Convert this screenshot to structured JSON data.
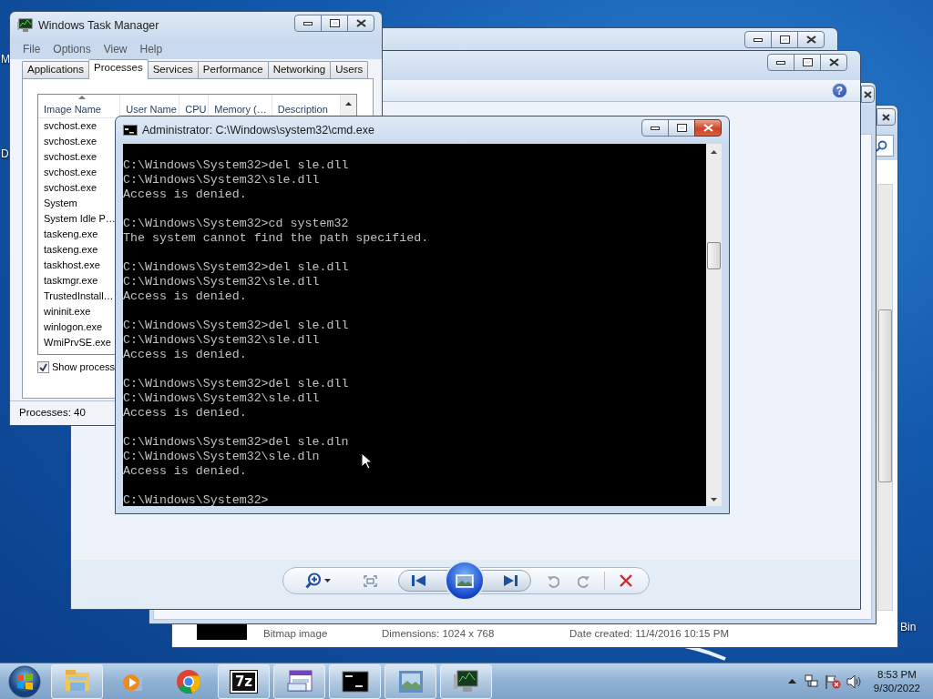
{
  "desktop": {
    "labels": [
      "M",
      "D",
      "Bin"
    ]
  },
  "explorer_window": {
    "details": [
      "Bitmap image",
      "Dimensions: 1024 x 768",
      "Date created: 11/4/2016 10:15 PM"
    ]
  },
  "photo_viewer": {
    "help_label": "?",
    "toolbar": [
      {
        "kind": "zoom"
      },
      {
        "kind": "fit"
      },
      {
        "kind": "nav"
      },
      {
        "kind": "rotate-left"
      },
      {
        "kind": "rotate-right"
      },
      {
        "kind": "separator"
      },
      {
        "kind": "delete"
      }
    ]
  },
  "task_manager": {
    "title": "Windows Task Manager",
    "menu": [
      "File",
      "Options",
      "View",
      "Help"
    ],
    "tabs": [
      {
        "label": "Applications",
        "selected": false
      },
      {
        "label": "Processes",
        "selected": true
      },
      {
        "label": "Services",
        "selected": false
      },
      {
        "label": "Performance",
        "selected": false
      },
      {
        "label": "Networking",
        "selected": false
      },
      {
        "label": "Users",
        "selected": false
      }
    ],
    "columns": [
      {
        "label": "Image Name",
        "sorted": true
      },
      {
        "label": "User Name",
        "sorted": false
      },
      {
        "label": "CPU",
        "sorted": false
      },
      {
        "label": "Memory (…",
        "sorted": false
      },
      {
        "label": "Description",
        "sorted": false
      }
    ],
    "rows": [
      "svchost.exe",
      "svchost.exe",
      "svchost.exe",
      "svchost.exe",
      "svchost.exe",
      "System",
      "System Idle P…",
      "taskeng.exe",
      "taskeng.exe",
      "taskhost.exe",
      "taskmgr.exe",
      "TrustedInstall…",
      "wininit.exe",
      "winlogon.exe",
      "WmiPrvSE.exe"
    ],
    "show_all": {
      "label": "Show process",
      "checked": true
    },
    "status": "Processes: 40"
  },
  "cmd": {
    "title": "Administrator: C:\\Windows\\system32\\cmd.exe",
    "blocks": [
      [
        "C:\\Windows\\System32>del sle.dll",
        "C:\\Windows\\System32\\sle.dll",
        "Access is denied."
      ],
      [
        "C:\\Windows\\System32>cd system32",
        "The system cannot find the path specified."
      ],
      [
        "C:\\Windows\\System32>del sle.dll",
        "C:\\Windows\\System32\\sle.dll",
        "Access is denied."
      ],
      [
        "C:\\Windows\\System32>del sle.dll",
        "C:\\Windows\\System32\\sle.dll",
        "Access is denied."
      ],
      [
        "C:\\Windows\\System32>del sle.dll",
        "C:\\Windows\\System32\\sle.dll",
        "Access is denied."
      ],
      [
        "C:\\Windows\\System32>del sle.dln",
        "C:\\Windows\\System32\\sle.dln",
        "Access is denied."
      ],
      [
        "C:\\Windows\\System32>"
      ]
    ]
  },
  "taskbar": {
    "items": [
      {
        "kind": "explorer",
        "running": true
      },
      {
        "kind": "media",
        "running": false
      },
      {
        "kind": "chrome",
        "running": false
      },
      {
        "kind": "sevenzip",
        "running": true,
        "glyph": "7z"
      },
      {
        "kind": "app",
        "running": true
      },
      {
        "kind": "cmd",
        "running": true
      },
      {
        "kind": "photos",
        "running": true
      },
      {
        "kind": "taskmgr",
        "running": true
      }
    ],
    "tray": [
      {
        "kind": "arrow"
      },
      {
        "kind": "network"
      },
      {
        "kind": "flag"
      },
      {
        "kind": "speaker"
      }
    ],
    "time": "8:53 PM",
    "date": "9/30/2022"
  }
}
